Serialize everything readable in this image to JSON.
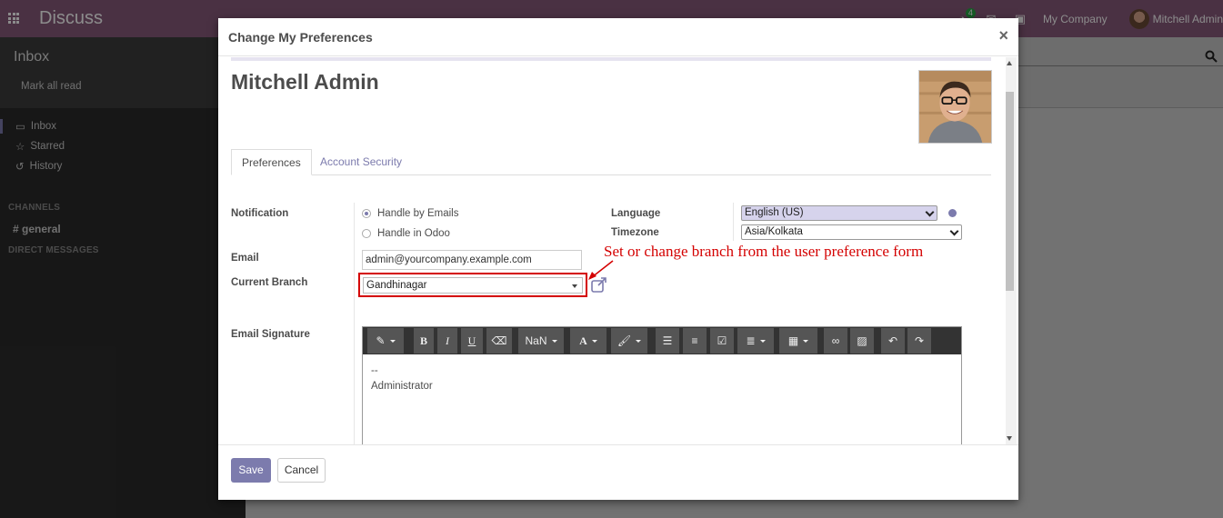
{
  "app": {
    "title": "Discuss",
    "company": "My Company",
    "user": "Mitchell Admin",
    "activity_badge": "4"
  },
  "sidebar": {
    "title": "Inbox",
    "mark_all": "Mark all read",
    "items": [
      {
        "label": "Inbox",
        "icon": "inbox-icon"
      },
      {
        "label": "Starred",
        "icon": "star-icon"
      },
      {
        "label": "History",
        "icon": "history-icon"
      }
    ],
    "channels_heading": "CHANNELS",
    "channel": "general",
    "dm_heading": "DIRECT MESSAGES"
  },
  "modal": {
    "title": "Change My Preferences",
    "close": "×",
    "user_name": "Mitchell Admin",
    "tabs": [
      {
        "label": "Preferences",
        "active": true
      },
      {
        "label": "Account Security",
        "active": false
      }
    ],
    "fields": {
      "notification_label": "Notification",
      "notification_options": [
        {
          "label": "Handle by Emails",
          "checked": true
        },
        {
          "label": "Handle in Odoo",
          "checked": false
        }
      ],
      "language_label": "Language",
      "language_value": "English (US)",
      "timezone_label": "Timezone",
      "timezone_value": "Asia/Kolkata",
      "email_label": "Email",
      "email_value": "admin@yourcompany.example.com",
      "branch_label": "Current Branch",
      "branch_value": "Gandhinagar",
      "signature_label": "Email Signature",
      "signature_lines": [
        "--",
        "Administrator"
      ]
    },
    "annotation": "Set or change branch from the user preference form",
    "toolbar": {
      "font_size": "NaN",
      "font_color": "A"
    },
    "footer": {
      "save": "Save",
      "cancel": "Cancel"
    }
  },
  "colors": {
    "brand": "#875a7b",
    "accent": "#7c7bad",
    "annotation": "#d40000"
  }
}
